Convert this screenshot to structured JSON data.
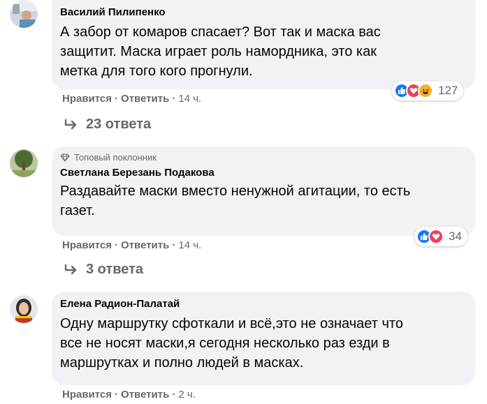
{
  "comments": [
    {
      "author": "Василий Пилипенко",
      "text_lines": [
        "А забор от комаров спасает? Вот так и маска вас",
        "защитит. Маска играет роль намордника, это как",
        "метка для того кого прогнули."
      ],
      "like_label": "Нравится",
      "reply_label": "Ответить",
      "time": "14 ч.",
      "reactions": [
        "like",
        "love",
        "haha"
      ],
      "reaction_count": "127",
      "replies_label": "23 ответа"
    },
    {
      "badge": "Топовый поклонник",
      "author": "Светлана Березань Подакова",
      "text_lines": [
        "Раздавайте маски вместо ненужной агитации, то есть",
        "газет."
      ],
      "like_label": "Нравится",
      "reply_label": "Ответить",
      "time": "14 ч.",
      "reactions": [
        "like",
        "love"
      ],
      "reaction_count": "34",
      "replies_label": "3 ответа"
    },
    {
      "author": "Елена Радион-Палатай",
      "text_lines": [
        "Одну маршрутку сфоткали и всё,это не означает что",
        "все не носят маски,я сегодня несколько раз езди в",
        "маршрутках и полно людей в масках."
      ],
      "like_label": "Нравится",
      "reply_label": "Ответить",
      "time": "2 ч."
    }
  ],
  "separator": "·",
  "colors": {
    "like": "#1877f2",
    "love": "#f33e58",
    "haha": "#f7b125",
    "bubble": "#f0f2f5",
    "meta": "#65676b"
  }
}
